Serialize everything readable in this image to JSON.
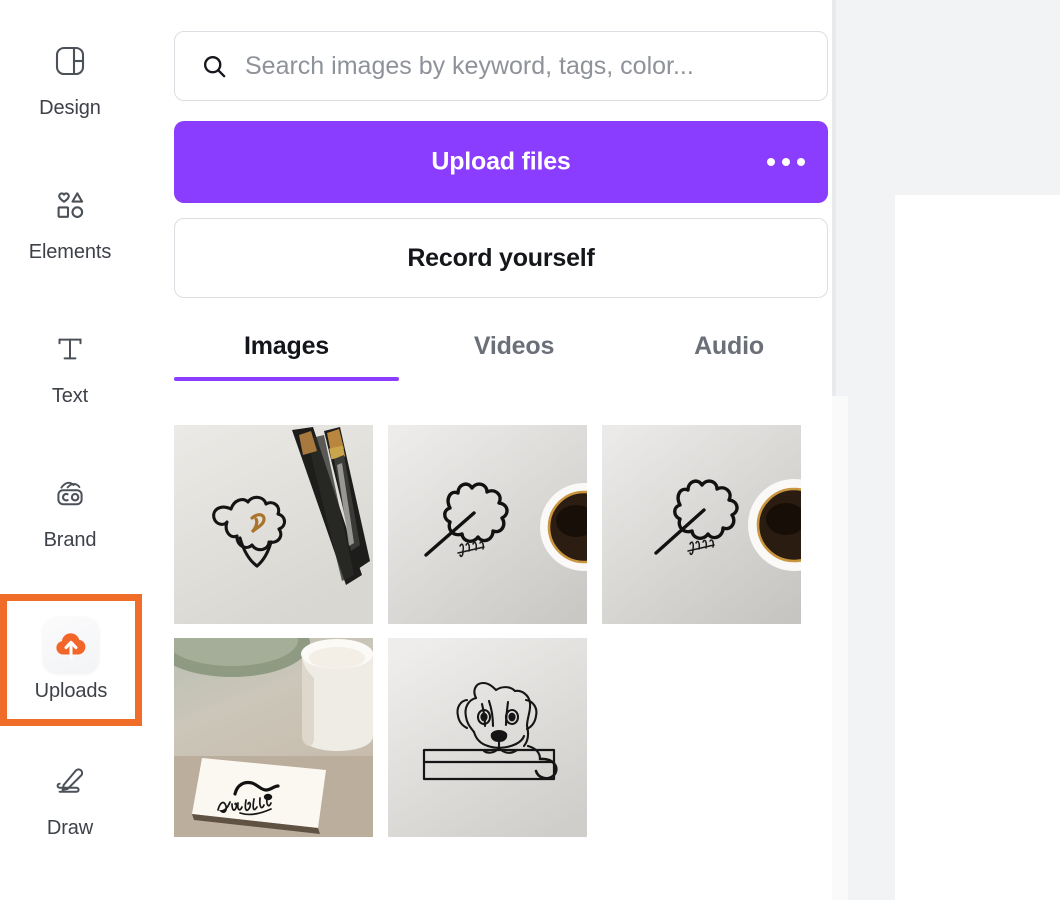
{
  "app": {
    "accent_purple": "#8b3dff",
    "highlight_orange": "#ef6c29",
    "panel_bg": "#ffffff",
    "canvas_bg": "#f2f3f5"
  },
  "sidebar": {
    "items": [
      {
        "id": "design",
        "label": "Design",
        "icon": "layout-icon",
        "active": false,
        "highlighted": false
      },
      {
        "id": "elements",
        "label": "Elements",
        "icon": "shapes-icon",
        "active": false,
        "highlighted": false
      },
      {
        "id": "text",
        "label": "Text",
        "icon": "text-t-icon",
        "active": false,
        "highlighted": false
      },
      {
        "id": "brand",
        "label": "Brand",
        "icon": "brand-co-icon",
        "active": false,
        "highlighted": false
      },
      {
        "id": "uploads",
        "label": "Uploads",
        "icon": "cloud-upload-icon",
        "active": true,
        "highlighted": true
      },
      {
        "id": "draw",
        "label": "Draw",
        "icon": "pen-draw-icon",
        "active": false,
        "highlighted": false
      }
    ]
  },
  "search": {
    "icon": "search-icon",
    "value": "",
    "placeholder": "Search images by keyword, tags, color..."
  },
  "actions": {
    "upload_label": "Upload files",
    "upload_more_icon": "ellipsis-icon",
    "record_label": "Record yourself"
  },
  "tabs": {
    "active": "Images",
    "items": [
      {
        "id": "images",
        "label": "Images"
      },
      {
        "id": "videos",
        "label": "Videos"
      },
      {
        "id": "audio",
        "label": "Audio"
      }
    ]
  },
  "gallery": {
    "items": [
      {
        "id": "thumb-1",
        "alt": "Line drawing of a bird shape beside three black pencils on white paper"
      },
      {
        "id": "thumb-2",
        "alt": "Line drawing of a leaf next to a cup of black coffee"
      },
      {
        "id": "thumb-3",
        "alt": "Line drawing of a leaf next to a cup of black coffee"
      },
      {
        "id": "thumb-4",
        "alt": "Handwritten sketch on a napkin beside a ceramic bowl"
      },
      {
        "id": "thumb-5",
        "alt": "Line drawing of a dog resting its head on a ledge"
      }
    ]
  },
  "canvas": {
    "scrollbar_label": "panel-scrollbar"
  }
}
